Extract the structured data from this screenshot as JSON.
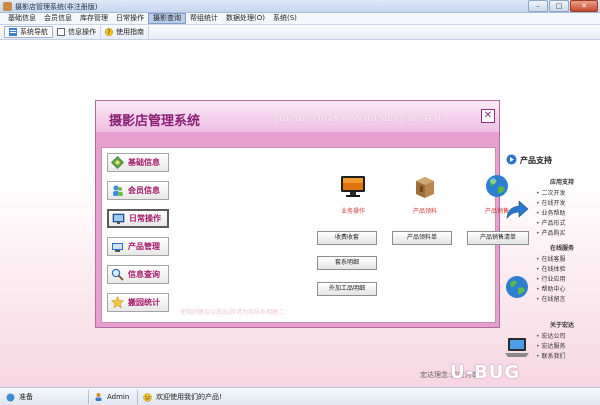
{
  "window": {
    "title": "摄影店管理系统(非注册版)",
    "buttons": {
      "minimize": "–",
      "maximize": "□",
      "close": "✕"
    }
  },
  "menu": [
    {
      "label": "基础信息"
    },
    {
      "label": "会员信息"
    },
    {
      "label": "库存管理"
    },
    {
      "label": "日常操作"
    },
    {
      "label": "摄影查询"
    },
    {
      "label": "帮组统计"
    },
    {
      "label": "数据处理(O)"
    },
    {
      "label": "系统(S)"
    }
  ],
  "toolbar": [
    {
      "label": "系统导航",
      "icon": "navigation-icon"
    },
    {
      "label": "信息操作",
      "icon": "info-icon"
    },
    {
      "label": "使用指南",
      "icon": "help-icon"
    }
  ],
  "dialog": {
    "title": "摄影店管理系统",
    "subtitle": "SHE YING DIAN MANAGEMENT SYSTEM",
    "close": "✕",
    "sidebar": [
      {
        "label": "基础信息",
        "icon": "basic-info-icon"
      },
      {
        "label": "会员信息",
        "icon": "member-icon"
      },
      {
        "label": "日常操作",
        "icon": "daily-ops-icon"
      },
      {
        "label": "产品管理",
        "icon": "product-icon"
      },
      {
        "label": "信息查询",
        "icon": "search-icon"
      },
      {
        "label": "搬园统计",
        "icon": "statistics-icon"
      }
    ],
    "features": [
      {
        "label": "业务操作",
        "icon": "monitor-icon"
      },
      {
        "label": "产品领料",
        "icon": "box-icon"
      },
      {
        "label": "产品销售",
        "icon": "globe-icon"
      }
    ],
    "buttons": {
      "fee": "收费收套",
      "material": "产品领料单",
      "sales": "产品销售清单",
      "package": "套系明细",
      "outsource": "外加工品明细"
    },
    "watermark": "使用好建议以提出/其请为指导系相建二"
  },
  "support": {
    "title": "产品支持",
    "sections": [
      {
        "title": "应用支持",
        "links": [
          "二次开发",
          "在线开发",
          "业务帮助",
          "产品形式",
          "产品购买"
        ]
      },
      {
        "title": "在线服务",
        "links": [
          "在线客服",
          "在线体验",
          "行业应用",
          "帮助中心",
          "在线留言"
        ]
      },
      {
        "title": "关于宏达",
        "links": [
          "宏达公司",
          "宏达服务",
          "联系我们"
        ]
      }
    ],
    "tagline": "宏达理念:诚信为本",
    "logo": "U-BUG"
  },
  "status": {
    "ready": "准备",
    "user": "Admin",
    "welcome": "欢迎使用我们的产品!"
  },
  "colors": {
    "accent": "#a8176a",
    "dialog_border": "#e6a0cf",
    "feature_label": "#d23a3a"
  }
}
